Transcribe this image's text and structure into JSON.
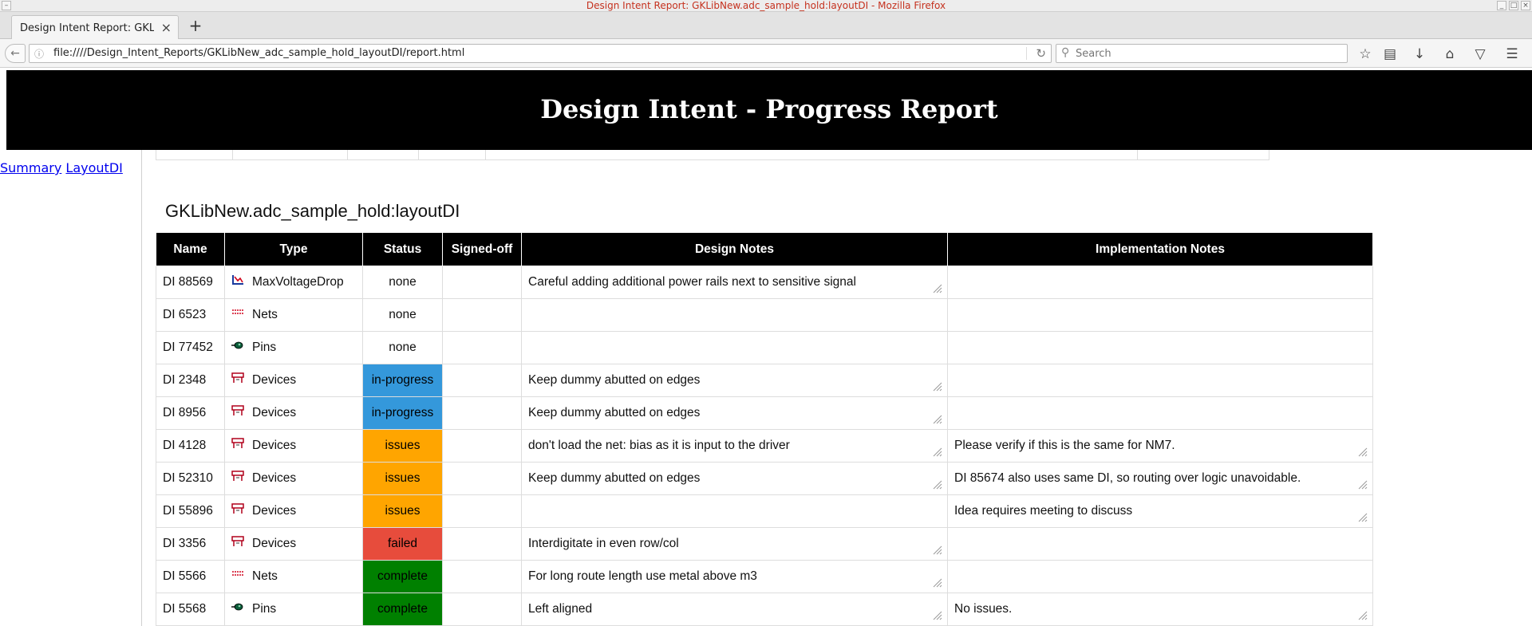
{
  "window": {
    "title": "Design Intent Report: GKLibNew.adc_sample_hold:layoutDI - Mozilla Firefox"
  },
  "tab": {
    "title": "Design Intent Report: GKLibNew.adc_sample_hold:layoutDI",
    "close": "×",
    "new_tab": "+"
  },
  "navbar": {
    "url": "file:////Design_Intent_Reports/GKLibNew_adc_sample_hold_layoutDI/report.html",
    "search_placeholder": "Search"
  },
  "header": {
    "title": "Design Intent - Progress Report"
  },
  "sidebar": {
    "links": [
      "Summary",
      "LayoutDI"
    ]
  },
  "section": {
    "title": "GKLibNew.adc_sample_hold:layoutDI"
  },
  "table": {
    "columns": [
      "Name",
      "Type",
      "Status",
      "Signed-off",
      "Design Notes",
      "Implementation Notes"
    ],
    "rows": [
      {
        "name": "DI 88569",
        "type": "MaxVoltageDrop",
        "icon": "voltage-drop-icon",
        "status": "none",
        "signed": "",
        "design": "Careful adding additional power rails next to sensitive signal",
        "impl": ""
      },
      {
        "name": "DI 6523",
        "type": "Nets",
        "icon": "nets-icon",
        "status": "none",
        "signed": "",
        "design": "",
        "impl": ""
      },
      {
        "name": "DI 77452",
        "type": "Pins",
        "icon": "pins-icon",
        "status": "none",
        "signed": "",
        "design": "",
        "impl": ""
      },
      {
        "name": "DI 2348",
        "type": "Devices",
        "icon": "devices-icon",
        "status": "in-progress",
        "signed": "",
        "design": "Keep dummy abutted on edges",
        "impl": ""
      },
      {
        "name": "DI 8956",
        "type": "Devices",
        "icon": "devices-icon",
        "status": "in-progress",
        "signed": "",
        "design": "Keep dummy abutted on edges",
        "impl": ""
      },
      {
        "name": "DI 4128",
        "type": "Devices",
        "icon": "devices-icon",
        "status": "issues",
        "signed": "",
        "design": "don't load the net: bias as it is input to the driver",
        "impl": "Please verify if this is the same for NM7."
      },
      {
        "name": "DI 52310",
        "type": "Devices",
        "icon": "devices-icon",
        "status": "issues",
        "signed": "",
        "design": "Keep dummy abutted on edges",
        "impl": "DI 85674 also uses same DI, so routing over logic unavoidable."
      },
      {
        "name": "DI 55896",
        "type": "Devices",
        "icon": "devices-icon",
        "status": "issues",
        "signed": "",
        "design": "",
        "impl": "Idea requires meeting to discuss"
      },
      {
        "name": "DI 3356",
        "type": "Devices",
        "icon": "devices-icon",
        "status": "failed",
        "signed": "",
        "design": "Interdigitate in even row/col",
        "impl": ""
      },
      {
        "name": "DI 5566",
        "type": "Nets",
        "icon": "nets-icon",
        "status": "complete",
        "signed": "",
        "design": "For long route length use metal above m3",
        "impl": ""
      },
      {
        "name": "DI 5568",
        "type": "Pins",
        "icon": "pins-icon",
        "status": "complete",
        "signed": "",
        "design": "Left aligned",
        "impl": "No issues."
      }
    ]
  },
  "status_colors": {
    "none": "#ffffff",
    "in-progress": "#3498db",
    "issues": "#ffa500",
    "failed": "#e74c3c",
    "complete": "#008000"
  }
}
